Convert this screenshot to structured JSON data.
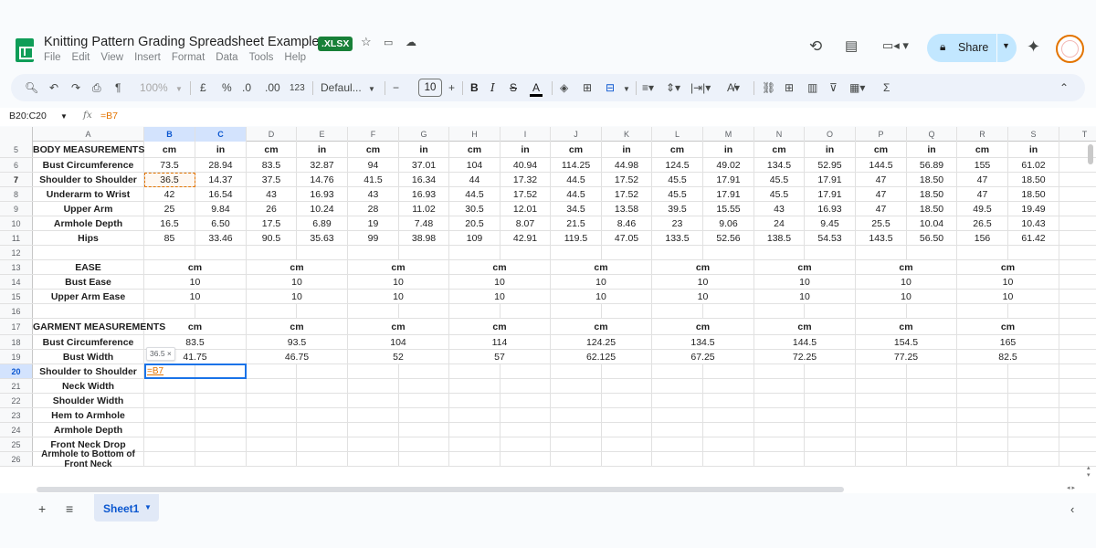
{
  "app": {
    "title": "Knitting Pattern Grading Spreadsheet Example",
    "badge": ".XLSX",
    "menu": [
      "File",
      "Edit",
      "View",
      "Insert",
      "Format",
      "Data",
      "Tools",
      "Help"
    ],
    "share_label": "Share"
  },
  "toolbar": {
    "zoom": "100%",
    "currency": "£",
    "percent": "%",
    "decrease_decimal": ".0",
    "increase_decimal": ".00",
    "number_format": "123",
    "font": "Defaul...",
    "font_size": "10",
    "bold": "B",
    "italic": "I",
    "text_color": "A",
    "functions": "Σ"
  },
  "formula_bar": {
    "name_box": "B20:C20",
    "fx": "fx",
    "value": "=B7"
  },
  "columns": [
    "A",
    "B",
    "C",
    "D",
    "E",
    "F",
    "G",
    "H",
    "I",
    "J",
    "K",
    "L",
    "M",
    "N",
    "O",
    "P",
    "Q",
    "R",
    "S",
    "T"
  ],
  "rows": [
    {
      "num": "5",
      "cells": [
        "BODY MEASUREMENTS",
        "cm",
        "in",
        "cm",
        "in",
        "cm",
        "in",
        "cm",
        "in",
        "cm",
        "in",
        "cm",
        "in",
        "cm",
        "in",
        "cm",
        "in",
        "cm",
        "in"
      ]
    },
    {
      "num": "6",
      "cells": [
        "Bust Circumference",
        "73.5",
        "28.94",
        "83.5",
        "32.87",
        "94",
        "37.01",
        "104",
        "40.94",
        "114.25",
        "44.98",
        "124.5",
        "49.02",
        "134.5",
        "52.95",
        "144.5",
        "56.89",
        "155",
        "61.02"
      ]
    },
    {
      "num": "7",
      "cells": [
        "Shoulder to Shoulder",
        "36.5",
        "14.37",
        "37.5",
        "14.76",
        "41.5",
        "16.34",
        "44",
        "17.32",
        "44.5",
        "17.52",
        "45.5",
        "17.91",
        "45.5",
        "17.91",
        "47",
        "18.50",
        "47",
        "18.50"
      ]
    },
    {
      "num": "8",
      "cells": [
        "Underarm to Wrist",
        "42",
        "16.54",
        "43",
        "16.93",
        "43",
        "16.93",
        "44.5",
        "17.52",
        "44.5",
        "17.52",
        "45.5",
        "17.91",
        "45.5",
        "17.91",
        "47",
        "18.50",
        "47",
        "18.50"
      ]
    },
    {
      "num": "9",
      "cells": [
        "Upper Arm",
        "25",
        "9.84",
        "26",
        "10.24",
        "28",
        "11.02",
        "30.5",
        "12.01",
        "34.5",
        "13.58",
        "39.5",
        "15.55",
        "43",
        "16.93",
        "47",
        "18.50",
        "49.5",
        "19.49"
      ]
    },
    {
      "num": "10",
      "cells": [
        "Armhole Depth",
        "16.5",
        "6.50",
        "17.5",
        "6.89",
        "19",
        "7.48",
        "20.5",
        "8.07",
        "21.5",
        "8.46",
        "23",
        "9.06",
        "24",
        "9.45",
        "25.5",
        "10.04",
        "26.5",
        "10.43"
      ]
    },
    {
      "num": "11",
      "cells": [
        "Hips",
        "85",
        "33.46",
        "90.5",
        "35.63",
        "99",
        "38.98",
        "109",
        "42.91",
        "119.5",
        "47.05",
        "133.5",
        "52.56",
        "138.5",
        "54.53",
        "143.5",
        "56.50",
        "156",
        "61.42"
      ]
    },
    {
      "num": "12",
      "cells": []
    },
    {
      "num": "13",
      "cells": [
        "EASE",
        "",
        "",
        "",
        "",
        "",
        "",
        "",
        "",
        "",
        "",
        "",
        "",
        "",
        "",
        "",
        "",
        "",
        ""
      ],
      "merged": [
        "cm",
        "cm",
        "cm",
        "cm",
        "cm",
        "cm",
        "cm",
        "cm",
        "cm"
      ]
    },
    {
      "num": "14",
      "cells": [
        "Bust Ease"
      ],
      "merged": [
        "10",
        "10",
        "10",
        "10",
        "10",
        "10",
        "10",
        "10",
        "10"
      ]
    },
    {
      "num": "15",
      "cells": [
        "Upper Arm Ease"
      ],
      "merged": [
        "10",
        "10",
        "10",
        "10",
        "10",
        "10",
        "10",
        "10",
        "10"
      ]
    },
    {
      "num": "16",
      "cells": []
    },
    {
      "num": "17",
      "cells": [
        "GARMENT MEASUREMENTS"
      ],
      "merged": [
        "cm",
        "cm",
        "cm",
        "cm",
        "cm",
        "cm",
        "cm",
        "cm",
        "cm"
      ]
    },
    {
      "num": "18",
      "cells": [
        "Bust Circumference"
      ],
      "merged": [
        "83.5",
        "93.5",
        "104",
        "114",
        "124.25",
        "134.5",
        "144.5",
        "154.5",
        "165"
      ]
    },
    {
      "num": "19",
      "cells": [
        "Bust Width"
      ],
      "merged": [
        "41.75",
        "46.75",
        "52",
        "57",
        "62.125",
        "67.25",
        "72.25",
        "77.25",
        "82.5"
      ]
    },
    {
      "num": "20",
      "cells": [
        "Shoulder to Shoulder"
      ]
    },
    {
      "num": "21",
      "cells": [
        "Neck Width"
      ]
    },
    {
      "num": "22",
      "cells": [
        "Shoulder Width"
      ]
    },
    {
      "num": "23",
      "cells": [
        "Hem to Armhole"
      ]
    },
    {
      "num": "24",
      "cells": [
        "Armhole Depth"
      ]
    },
    {
      "num": "25",
      "cells": [
        "Front Neck Drop"
      ]
    },
    {
      "num": "26",
      "cells": [
        "Armhole to Bottom of Front Neck"
      ]
    }
  ],
  "editing": {
    "cell_text": "=B7",
    "preview_chip": "36.5 ×"
  },
  "bottom": {
    "sheet_tab": "Sheet1"
  },
  "colors": {
    "accent": "#1a73e8",
    "share_bg": "#c2e7ff",
    "sheets_green": "#0f9d58",
    "reference_orange": "#e37400"
  }
}
